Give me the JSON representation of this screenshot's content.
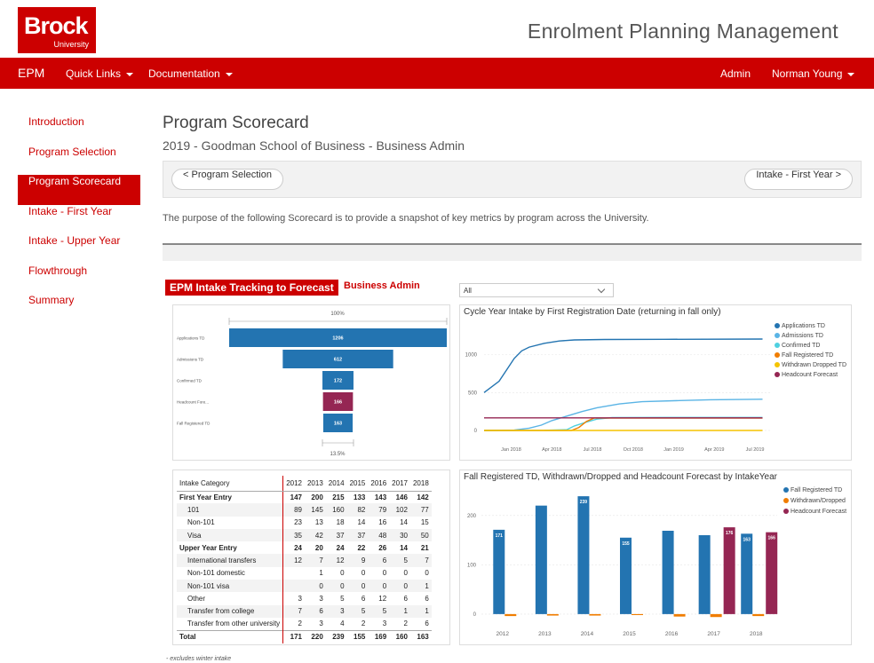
{
  "header": {
    "logo_text": "Brock",
    "logo_subtext": "University",
    "app_title": "Enrolment Planning Management"
  },
  "navbar": {
    "brand": "EPM",
    "quick_links": "Quick Links",
    "documentation": "Documentation",
    "admin": "Admin",
    "user": "Norman Young"
  },
  "sidebar": {
    "items": [
      {
        "label": "Introduction"
      },
      {
        "label": "Program Selection"
      },
      {
        "label": "Program Scorecard"
      },
      {
        "label": "Intake - First Year"
      },
      {
        "label": "Intake - Upper Year"
      },
      {
        "label": "Flowthrough"
      },
      {
        "label": "Summary"
      }
    ]
  },
  "main": {
    "title": "Program Scorecard",
    "subtitle": "2019 - Goodman School of Business - Business Admin",
    "back_button": "< Program Selection",
    "next_button": "Intake - First Year >",
    "purpose": "The purpose of the following Scorecard is to provide a snapshot of key metrics by program across the University."
  },
  "report": {
    "title": "EPM Intake Tracking to Forecast",
    "program": "Business Admin",
    "dropdown_value": "All",
    "footnote": "- excludes winter intake"
  },
  "colors": {
    "brand_red": "#cc0000",
    "blue": "#2374b1",
    "light_blue": "#5ab4e5",
    "cyan": "#4fd0e0",
    "orange": "#f07d00",
    "yellow": "#f5c400",
    "maroon": "#952653"
  },
  "chart_data": [
    {
      "type": "bar",
      "name": "funnel",
      "top_label": "100%",
      "bottom_label": "13.5%",
      "categories": [
        "Applications TD",
        "Admissions TD",
        "Confirmed TD",
        "Headcount Fore...",
        "Fall Registered TD"
      ],
      "values": [
        1206,
        612,
        172,
        166,
        163
      ],
      "xlim": [
        0,
        1206
      ],
      "colors": [
        "#2374b1",
        "#2374b1",
        "#2374b1",
        "#952653",
        "#2374b1"
      ]
    },
    {
      "type": "line",
      "title": "Cycle Year Intake by First Registration Date (returning in fall only)",
      "x_ticks": [
        "Jan 2018",
        "Apr 2018",
        "Jul 2018",
        "Oct 2018",
        "Jan 2019",
        "Apr 2019",
        "Jul 2019"
      ],
      "y_ticks": [
        0,
        500,
        1000
      ],
      "ylim": [
        0,
        1300
      ],
      "xlim": [
        0,
        19
      ],
      "legend_position": "right",
      "series": [
        {
          "name": "Applications TD",
          "color": "#2374b1",
          "points": [
            [
              0,
              500
            ],
            [
              1,
              650
            ],
            [
              1.5,
              800
            ],
            [
              2,
              950
            ],
            [
              2.5,
              1050
            ],
            [
              3,
              1100
            ],
            [
              4,
              1150
            ],
            [
              5,
              1180
            ],
            [
              6,
              1195
            ],
            [
              8,
              1200
            ],
            [
              12,
              1203
            ],
            [
              18.5,
              1206
            ]
          ]
        },
        {
          "name": "Admissions TD",
          "color": "#5ab4e5",
          "points": [
            [
              0,
              0
            ],
            [
              2,
              5
            ],
            [
              3,
              30
            ],
            [
              3.8,
              70
            ],
            [
              4.5,
              130
            ],
            [
              5.5,
              190
            ],
            [
              6.5,
              250
            ],
            [
              7.5,
              300
            ],
            [
              9,
              350
            ],
            [
              10.5,
              380
            ],
            [
              13,
              395
            ],
            [
              15,
              405
            ],
            [
              18.5,
              412
            ]
          ]
        },
        {
          "name": "Confirmed TD",
          "color": "#4fd0e0",
          "points": [
            [
              0,
              0
            ],
            [
              4,
              2
            ],
            [
              5.5,
              10
            ],
            [
              6,
              60
            ],
            [
              6.8,
              110
            ],
            [
              7.5,
              150
            ],
            [
              8.5,
              170
            ],
            [
              12,
              172
            ],
            [
              18.5,
              172
            ]
          ]
        },
        {
          "name": "Fall Registered TD",
          "color": "#f07d00",
          "points": [
            [
              0,
              0
            ],
            [
              5.8,
              0
            ],
            [
              6.3,
              40
            ],
            [
              6.8,
              120
            ],
            [
              7.3,
              163
            ],
            [
              18.5,
              163
            ]
          ]
        },
        {
          "name": "Withdrawn Dropped TD",
          "color": "#f5c400",
          "points": [
            [
              0,
              0
            ],
            [
              18.5,
              0
            ]
          ]
        },
        {
          "name": "Headcount Forecast",
          "color": "#952653",
          "points": [
            [
              0,
              166
            ],
            [
              18.5,
              166
            ]
          ]
        }
      ]
    },
    {
      "type": "bar",
      "title": "Fall Registered TD, Withdrawn/Dropped and Headcount Forecast by IntakeYear",
      "categories": [
        "2012",
        "2013",
        "2014",
        "2015",
        "2016",
        "2017",
        "2018"
      ],
      "y_ticks": [
        0,
        100,
        200
      ],
      "ylim": [
        -20,
        250
      ],
      "legend_position": "right",
      "series": [
        {
          "name": "Fall Registered TD",
          "color": "#2374b1",
          "values": [
            171,
            220,
            239,
            155,
            169,
            160,
            163
          ],
          "labels": [
            "171",
            "",
            "239",
            "155",
            "",
            "",
            "163"
          ]
        },
        {
          "name": "Withdrawn/Dropped",
          "color": "#f07d00",
          "values": [
            -4,
            -3,
            -3,
            -2,
            -5,
            -6,
            -4
          ],
          "labels": [
            "",
            "",
            "",
            "",
            "",
            "",
            ""
          ]
        },
        {
          "name": "Headcount Forecast",
          "color": "#952653",
          "values": [
            null,
            null,
            null,
            null,
            null,
            176,
            166
          ],
          "labels": [
            "",
            "",
            "",
            "",
            "",
            "176",
            "166"
          ]
        }
      ]
    },
    {
      "type": "table",
      "columns": [
        "Intake Category",
        "2012",
        "2013",
        "2014",
        "2015",
        "2016",
        "2017",
        "2018"
      ],
      "rows": [
        {
          "label": "First Year Entry",
          "values": [
            "147",
            "200",
            "215",
            "133",
            "143",
            "146",
            "142"
          ],
          "style": "bold"
        },
        {
          "label": "101",
          "values": [
            "89",
            "145",
            "160",
            "82",
            "79",
            "102",
            "77"
          ],
          "style": "sub shade"
        },
        {
          "label": "Non-101",
          "values": [
            "23",
            "13",
            "18",
            "14",
            "16",
            "14",
            "15"
          ],
          "style": "sub"
        },
        {
          "label": "Visa",
          "values": [
            "35",
            "42",
            "37",
            "37",
            "48",
            "30",
            "50"
          ],
          "style": "sub shade"
        },
        {
          "label": "Upper Year Entry",
          "values": [
            "24",
            "20",
            "24",
            "22",
            "26",
            "14",
            "21"
          ],
          "style": "bold"
        },
        {
          "label": "International transfers",
          "values": [
            "12",
            "7",
            "12",
            "9",
            "6",
            "5",
            "7"
          ],
          "style": "sub shade"
        },
        {
          "label": "Non-101 domestic",
          "values": [
            "",
            "1",
            "0",
            "0",
            "0",
            "0",
            "0"
          ],
          "style": "sub"
        },
        {
          "label": "Non-101 visa",
          "values": [
            "",
            "0",
            "0",
            "0",
            "0",
            "0",
            "1"
          ],
          "style": "sub shade"
        },
        {
          "label": "Other",
          "values": [
            "3",
            "3",
            "5",
            "6",
            "12",
            "6",
            "6"
          ],
          "style": "sub"
        },
        {
          "label": "Transfer from college",
          "values": [
            "7",
            "6",
            "3",
            "5",
            "5",
            "1",
            "1"
          ],
          "style": "sub shade"
        },
        {
          "label": "Transfer from other university",
          "values": [
            "2",
            "3",
            "4",
            "2",
            "3",
            "2",
            "6"
          ],
          "style": "sub"
        },
        {
          "label": "Total",
          "values": [
            "171",
            "220",
            "239",
            "155",
            "169",
            "160",
            "163"
          ],
          "style": "total"
        }
      ]
    }
  ]
}
